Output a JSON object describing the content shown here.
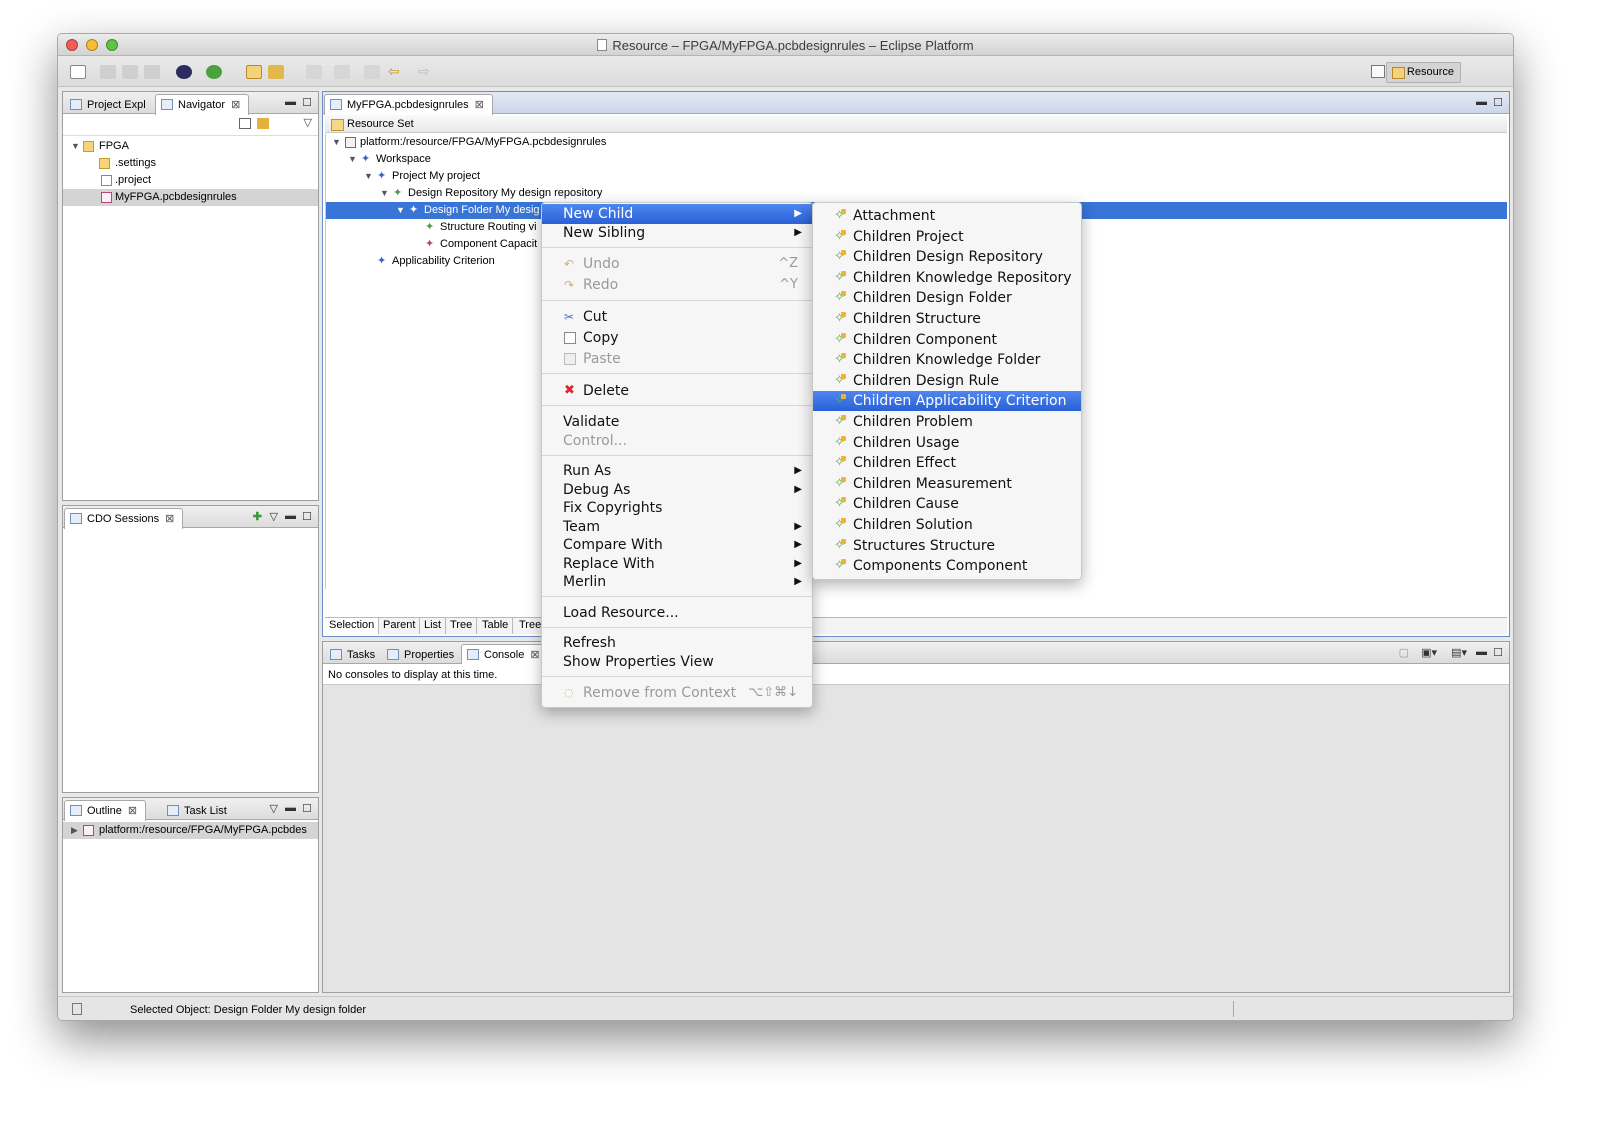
{
  "window": {
    "title": "Resource – FPGA/MyFPGA.pcbdesignrules – Eclipse Platform",
    "perspective_label": "Resource"
  },
  "left_top": {
    "tabs": [
      "Project Expl",
      "Navigator"
    ],
    "tree": [
      {
        "label": "FPGA",
        "expanded": true,
        "icon": "project-folder-icon"
      },
      {
        "label": ".settings",
        "icon": "folder-icon"
      },
      {
        "label": ".project",
        "icon": "file-icon"
      },
      {
        "label": "MyFPGA.pcbdesignrules",
        "icon": "model-file-icon",
        "selected": true
      }
    ]
  },
  "left_mid": {
    "tab": "CDO Sessions"
  },
  "left_bot": {
    "tabs": [
      "Outline",
      "Task List"
    ],
    "tree": [
      {
        "label": "platform:/resource/FPGA/MyFPGA.pcbdes",
        "icon": "model-file-icon"
      }
    ]
  },
  "editor": {
    "tab": "MyFPGA.pcbdesignrules",
    "header": "Resource Set",
    "tree": [
      {
        "label": "platform:/resource/FPGA/MyFPGA.pcbdesignrules",
        "expanded": true
      },
      {
        "label": "Workspace",
        "expanded": true
      },
      {
        "label": "Project My project",
        "expanded": true
      },
      {
        "label": "Design Repository My design repository",
        "expanded": true
      },
      {
        "label": "Design Folder My desig",
        "expanded": true,
        "selected": true
      },
      {
        "label": "Structure Routing vi"
      },
      {
        "label": "Component Capacit"
      },
      {
        "label": "Applicability Criterion"
      }
    ],
    "bottom_tabs": [
      "Selection",
      "Parent",
      "List",
      "Tree",
      "Table",
      "Tree"
    ]
  },
  "bottom": {
    "tabs": [
      "Tasks",
      "Properties",
      "Console"
    ],
    "message": "No consoles to display at this time."
  },
  "status": {
    "text": "Selected Object: Design Folder My design folder"
  },
  "context_menu": {
    "items": [
      {
        "label": "New Child",
        "submenu": true,
        "highlighted": true
      },
      {
        "label": "New Sibling",
        "submenu": true
      },
      {
        "label": "Undo",
        "shortcut": "^Z",
        "disabled": true,
        "icon": "undo-icon"
      },
      {
        "label": "Redo",
        "shortcut": "^Y",
        "disabled": true,
        "icon": "redo-icon"
      },
      {
        "label": "Cut",
        "icon": "cut-icon"
      },
      {
        "label": "Copy",
        "icon": "copy-icon"
      },
      {
        "label": "Paste",
        "disabled": true,
        "icon": "paste-icon"
      },
      {
        "label": "Delete",
        "icon": "delete-icon"
      },
      {
        "label": "Validate"
      },
      {
        "label": "Control...",
        "disabled": true
      },
      {
        "label": "Run As",
        "submenu": true
      },
      {
        "label": "Debug As",
        "submenu": true
      },
      {
        "label": "Fix Copyrights"
      },
      {
        "label": "Team",
        "submenu": true
      },
      {
        "label": "Compare With",
        "submenu": true
      },
      {
        "label": "Replace With",
        "submenu": true
      },
      {
        "label": "Merlin",
        "submenu": true
      },
      {
        "label": "Load Resource..."
      },
      {
        "label": "Refresh"
      },
      {
        "label": "Show Properties View"
      },
      {
        "label": "Remove from Context",
        "shortcut": "⌥⇧⌘↓",
        "disabled": true,
        "icon": "remove-context-icon"
      }
    ]
  },
  "submenu": {
    "items": [
      "Attachment",
      "Children Project",
      "Children Design Repository",
      "Children Knowledge Repository",
      "Children Design Folder",
      "Children Structure",
      "Children Component",
      "Children Knowledge Folder",
      "Children Design Rule",
      "Children Applicability Criterion",
      "Children Problem",
      "Children Usage",
      "Children Effect",
      "Children Measurement",
      "Children Cause",
      "Children Solution",
      "Structures Structure",
      "Components Component"
    ],
    "highlighted_index": 9
  },
  "colors": {
    "selection": "#3875d7",
    "menu_highlight": "#2f66dc",
    "close_button": "#f25d55",
    "min_button": "#f7be35",
    "max_button": "#5fc440"
  }
}
